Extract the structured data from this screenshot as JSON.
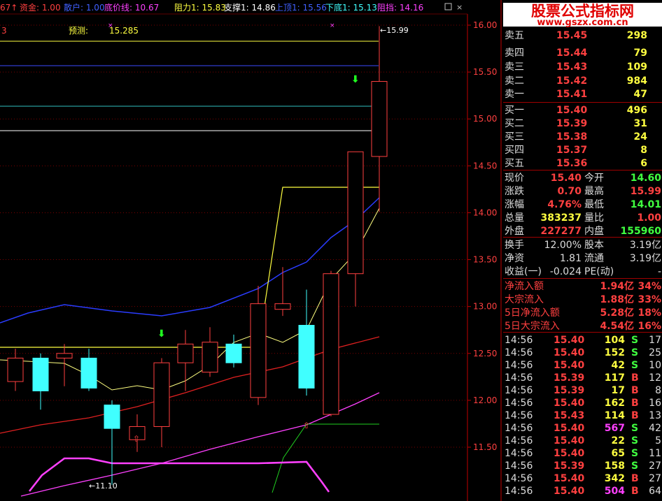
{
  "header": {
    "prefix": "67",
    "items": [
      {
        "label": "资金: 1.00",
        "color": "#ff4040"
      },
      {
        "label": "散户: 1.00",
        "color": "#4060ff"
      },
      {
        "label": "底价线: 10.67",
        "color": "#ff40ff"
      },
      {
        "label": "阻力1: 15.83",
        "color": "#ffff40"
      },
      {
        "label": "支撑1: 14.86",
        "color": "#ffffff"
      },
      {
        "label": "上顶1: 15.56",
        "color": "#4060ff"
      },
      {
        "label": "下底1: 15.13",
        "color": "#40ffff"
      },
      {
        "label": "阻挡: 14.16",
        "color": "#ff40ff"
      }
    ]
  },
  "subheader": {
    "left": "3",
    "forecast_label": "预测:",
    "forecast_value": "15.285"
  },
  "watermark": {
    "title": "股票公式指标网",
    "url": "www.gszx.com.cn"
  },
  "price_axis": {
    "ticks": [
      "16.00",
      "15.50",
      "15.00",
      "14.50",
      "14.00",
      "13.50",
      "13.00",
      "12.50",
      "12.00",
      "11.50"
    ]
  },
  "annotations": {
    "high": "15.99",
    "low": "11.10"
  },
  "orderbook": {
    "asks": [
      {
        "label": "卖五",
        "price": "15.45",
        "vol": "298"
      },
      {
        "label": "卖四",
        "price": "15.44",
        "vol": "79"
      },
      {
        "label": "卖三",
        "price": "15.43",
        "vol": "109"
      },
      {
        "label": "卖二",
        "price": "15.42",
        "vol": "984"
      },
      {
        "label": "卖一",
        "price": "15.41",
        "vol": "47"
      }
    ],
    "bids": [
      {
        "label": "买一",
        "price": "15.40",
        "vol": "496"
      },
      {
        "label": "买二",
        "price": "15.39",
        "vol": "31"
      },
      {
        "label": "买三",
        "price": "15.38",
        "vol": "24"
      },
      {
        "label": "买四",
        "price": "15.37",
        "vol": "8"
      },
      {
        "label": "买五",
        "price": "15.36",
        "vol": "6"
      }
    ]
  },
  "stats": [
    {
      "l1": "现价",
      "v1": "15.40",
      "c1": "#ff4040",
      "l2": "今开",
      "v2": "14.60",
      "c2": "#40ff40"
    },
    {
      "l1": "涨跌",
      "v1": "0.70",
      "c1": "#ff4040",
      "l2": "最高",
      "v2": "15.99",
      "c2": "#ff4040"
    },
    {
      "l1": "涨幅",
      "v1": "4.76%",
      "c1": "#ff4040",
      "l2": "最低",
      "v2": "14.01",
      "c2": "#40ff40"
    },
    {
      "l1": "总量",
      "v1": "383237",
      "c1": "#ffff40",
      "l2": "量比",
      "v2": "1.00",
      "c2": "#ff4040"
    },
    {
      "l1": "外盘",
      "v1": "227277",
      "c1": "#ff4040",
      "l2": "内盘",
      "v2": "155960",
      "c2": "#40ff40"
    }
  ],
  "stats2": [
    {
      "l1": "换手",
      "v1": "12.00%",
      "l2": "股本",
      "v2": "3.19亿"
    },
    {
      "l1": "净资",
      "v1": "1.81",
      "l2": "流通",
      "v2": "3.19亿"
    },
    {
      "l1": "收益(一)",
      "v1": "-0.024",
      "l2": "PE(动)",
      "v2": "-"
    }
  ],
  "flows": [
    {
      "label": "净流入额",
      "value": "1.94亿",
      "pct": "34%"
    },
    {
      "label": "大宗流入",
      "value": "1.88亿",
      "pct": "33%"
    },
    {
      "label": "5日净流入额",
      "value": "5.28亿",
      "pct": "18%"
    },
    {
      "label": "5日大宗流入",
      "value": "4.54亿",
      "pct": "16%"
    }
  ],
  "ticks": [
    {
      "time": "14:56",
      "price": "15.40",
      "vol": "104",
      "side": "S",
      "n": "17"
    },
    {
      "time": "14:56",
      "price": "15.40",
      "vol": "152",
      "side": "S",
      "n": "25"
    },
    {
      "time": "14:56",
      "price": "15.40",
      "vol": "42",
      "side": "S",
      "n": "10"
    },
    {
      "time": "14:56",
      "price": "15.39",
      "vol": "117",
      "side": "B",
      "n": "12"
    },
    {
      "time": "14:56",
      "price": "15.39",
      "vol": "17",
      "side": "B",
      "n": "8"
    },
    {
      "time": "14:56",
      "price": "15.40",
      "vol": "162",
      "side": "B",
      "n": "16"
    },
    {
      "time": "14:56",
      "price": "15.43",
      "vol": "114",
      "side": "B",
      "n": "13"
    },
    {
      "time": "14:56",
      "price": "15.40",
      "vol": "567",
      "side": "S",
      "n": "42",
      "hi": true
    },
    {
      "time": "14:56",
      "price": "15.40",
      "vol": "22",
      "side": "S",
      "n": "5"
    },
    {
      "time": "14:56",
      "price": "15.40",
      "vol": "65",
      "side": "S",
      "n": "11"
    },
    {
      "time": "14:56",
      "price": "15.39",
      "vol": "158",
      "side": "S",
      "n": "27"
    },
    {
      "time": "14:56",
      "price": "15.40",
      "vol": "342",
      "side": "B",
      "n": "27"
    },
    {
      "time": "14:56",
      "price": "15.40",
      "vol": "504",
      "side": "B",
      "n": "64",
      "hi": true
    }
  ],
  "candles": [
    {
      "o": 12.2,
      "h": 12.55,
      "l": 12.1,
      "c": 12.45
    },
    {
      "o": 12.45,
      "h": 12.5,
      "l": 11.9,
      "c": 12.1
    },
    {
      "o": 12.45,
      "h": 12.6,
      "l": 12.15,
      "c": 12.5
    },
    {
      "o": 12.45,
      "h": 12.55,
      "l": 12.1,
      "c": 12.13
    },
    {
      "o": 11.95,
      "h": 12.0,
      "l": 11.1,
      "c": 11.7
    },
    {
      "o": 11.58,
      "h": 11.85,
      "l": 11.45,
      "c": 11.72
    },
    {
      "o": 11.72,
      "h": 12.45,
      "l": 11.5,
      "c": 12.4
    },
    {
      "o": 12.4,
      "h": 12.75,
      "l": 12.1,
      "c": 12.6
    },
    {
      "o": 12.3,
      "h": 12.78,
      "l": 12.25,
      "c": 12.62
    },
    {
      "o": 12.6,
      "h": 12.7,
      "l": 12.35,
      "c": 12.4
    },
    {
      "o": 12.03,
      "h": 13.22,
      "l": 11.95,
      "c": 13.03
    },
    {
      "o": 12.97,
      "h": 13.42,
      "l": 12.9,
      "c": 13.03
    },
    {
      "o": 12.8,
      "h": 13.18,
      "l": 12.05,
      "c": 12.13
    },
    {
      "o": 11.85,
      "h": 13.38,
      "l": 11.83,
      "c": 13.35
    },
    {
      "o": 13.35,
      "h": 14.65,
      "l": 13.0,
      "c": 14.65
    },
    {
      "o": 14.7,
      "h": 15.3,
      "l": 14.01,
      "c": 14.66
    },
    {
      "o": 14.6,
      "h": 15.99,
      "l": 14.01,
      "c": 15.4
    }
  ]
}
